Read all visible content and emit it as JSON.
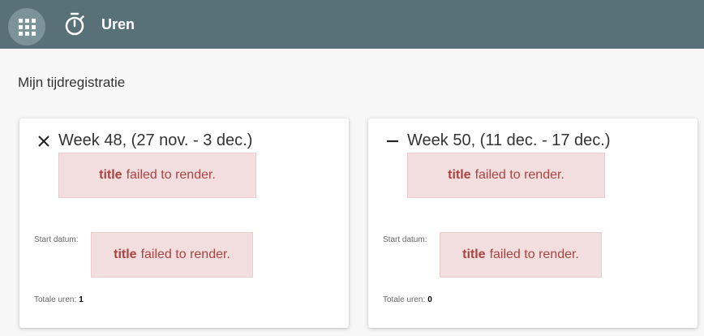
{
  "header": {
    "apps_icon": "apps-grid-icon",
    "app_icon": "stopwatch-icon",
    "title": "Uren",
    "bg_color": "#587178"
  },
  "page": {
    "title": "Mijn tijdregistratie"
  },
  "cards": [
    {
      "toggle_icon": "close-icon",
      "week_label": "Week 48, (27 nov. - 3 dec.)",
      "error_top": {
        "strong": "title",
        "text": "failed to render."
      },
      "start_label": "Start datum:",
      "error_start": {
        "strong": "title",
        "text": "failed to render."
      },
      "total_label": "Totale uren:",
      "total_value": "1"
    },
    {
      "toggle_icon": "minus-icon",
      "week_label": "Week 50, (11 dec. - 17 dec.)",
      "error_top": {
        "strong": "title",
        "text": "failed to render."
      },
      "start_label": "Start datum:",
      "error_start": {
        "strong": "title",
        "text": "failed to render."
      },
      "total_label": "Totale uren:",
      "total_value": "0"
    }
  ]
}
